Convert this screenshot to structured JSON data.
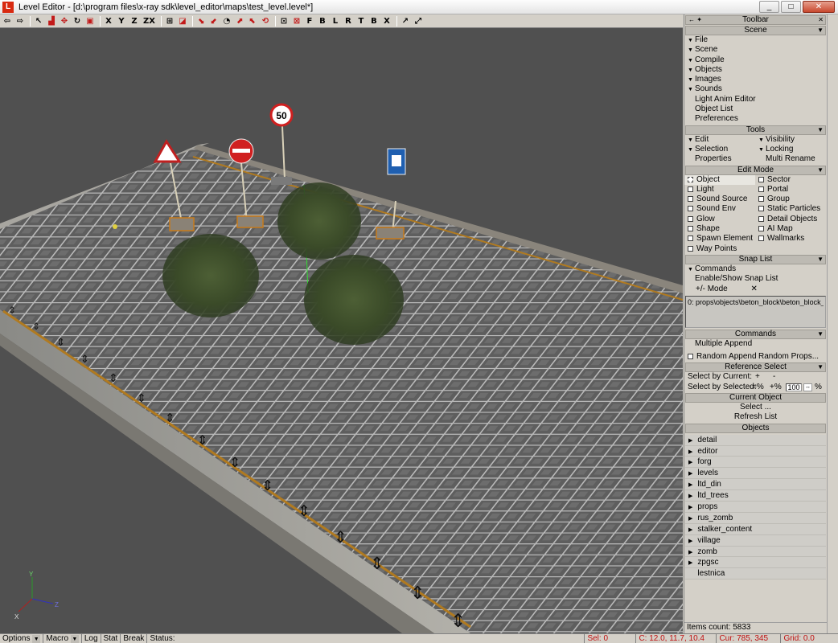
{
  "window": {
    "icon_label": "L",
    "title": "Level Editor - [d:\\program files\\x-ray sdk\\level_editor\\maps\\test_level.level*]",
    "min": "_",
    "max": "□",
    "close": "✕"
  },
  "toolbar": {
    "axis": [
      "X",
      "Y",
      "Z",
      "ZX"
    ],
    "views": [
      "F",
      "B",
      "L",
      "R",
      "T",
      "B",
      "X"
    ]
  },
  "scene": {
    "road_signs": [
      "50"
    ],
    "axis_labels": [
      "Y",
      "X",
      "Z"
    ]
  },
  "panel": {
    "header": "Toolbar",
    "header_left": "← ✦",
    "scene_title": "Scene",
    "scene_items": [
      "File",
      "Scene",
      "Compile",
      "Objects",
      "Images",
      "Sounds"
    ],
    "scene_links": [
      "Light Anim Editor",
      "Object List",
      "Preferences"
    ],
    "tools_title": "Tools",
    "tools": {
      "edit": "Edit",
      "visibility": "Visibility",
      "selection": "Selection",
      "locking": "Locking",
      "properties": "Properties",
      "multi_rename": "Multi Rename"
    },
    "edit_mode_title": "Edit Mode",
    "edit_mode_left": [
      "Object",
      "Light",
      "Sound Source",
      "Sound Env",
      "Glow",
      "Shape",
      "Spawn Element",
      "Way Points"
    ],
    "edit_mode_right": [
      "Sector",
      "Portal",
      "Group",
      "Static Particles",
      "Detail Objects",
      "AI Map",
      "Wallmarks"
    ],
    "snap_title": "Snap List",
    "snap_commands": "Commands",
    "snap_enable": "Enable/Show Snap List",
    "snap_mode": "+/- Mode",
    "snap_close": "✕",
    "snap_entry": "0: props\\objects\\beton_block\\beton_block_",
    "commands_title": "Commands",
    "multiple_append": "Multiple Append",
    "random_append": "Random Append",
    "random_props": "Random Props...",
    "ref_title": "Reference Select",
    "select_by_current": "Select by Current:",
    "select_by_selected": "Select by Selected:",
    "plus": "+",
    "minus": "-",
    "minus_pct": "=%",
    "plus_pct": "+%",
    "pct_value": "100",
    "pct_sign": "%",
    "current_title": "Current Object",
    "select": "Select ...",
    "refresh": "Refresh List",
    "objects_title": "Objects",
    "objects": [
      "detail",
      "editor",
      "forg",
      "levels",
      "ltd_din",
      "ltd_trees",
      "props",
      "rus_zomb",
      "stalker_content",
      "village",
      "zomb",
      "zpgsc",
      "lestnica"
    ],
    "items_count": "Items count: 5833"
  },
  "status": {
    "options": "Options",
    "macro": "Macro",
    "log": "Log",
    "stat": "Stat",
    "break": "Break",
    "status_label": "Status:",
    "sel": "Sel: 0",
    "coords": "C: 12.0, 11.7, 10.4",
    "cursor": "Cur: 785, 345",
    "grid": "Grid: 0.0"
  }
}
